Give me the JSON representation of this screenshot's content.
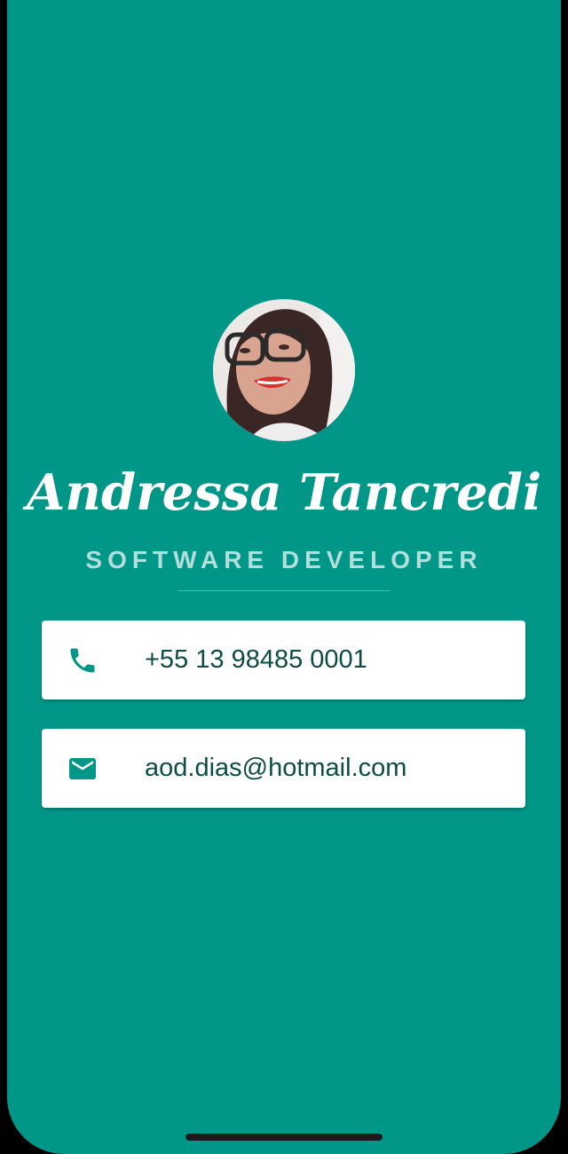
{
  "profile": {
    "name": "Andressa Tancredi",
    "title": "SOFTWARE DEVELOPER"
  },
  "contacts": [
    {
      "type": "phone",
      "icon": "phone-icon",
      "value": "+55 13 98485 0001"
    },
    {
      "type": "email",
      "icon": "mail-icon",
      "value": "aod.dias@hotmail.com"
    }
  ],
  "colors": {
    "background": "#009688",
    "card": "#ffffff",
    "text": "#0d4d45",
    "subtitle": "#b2dfdb"
  }
}
